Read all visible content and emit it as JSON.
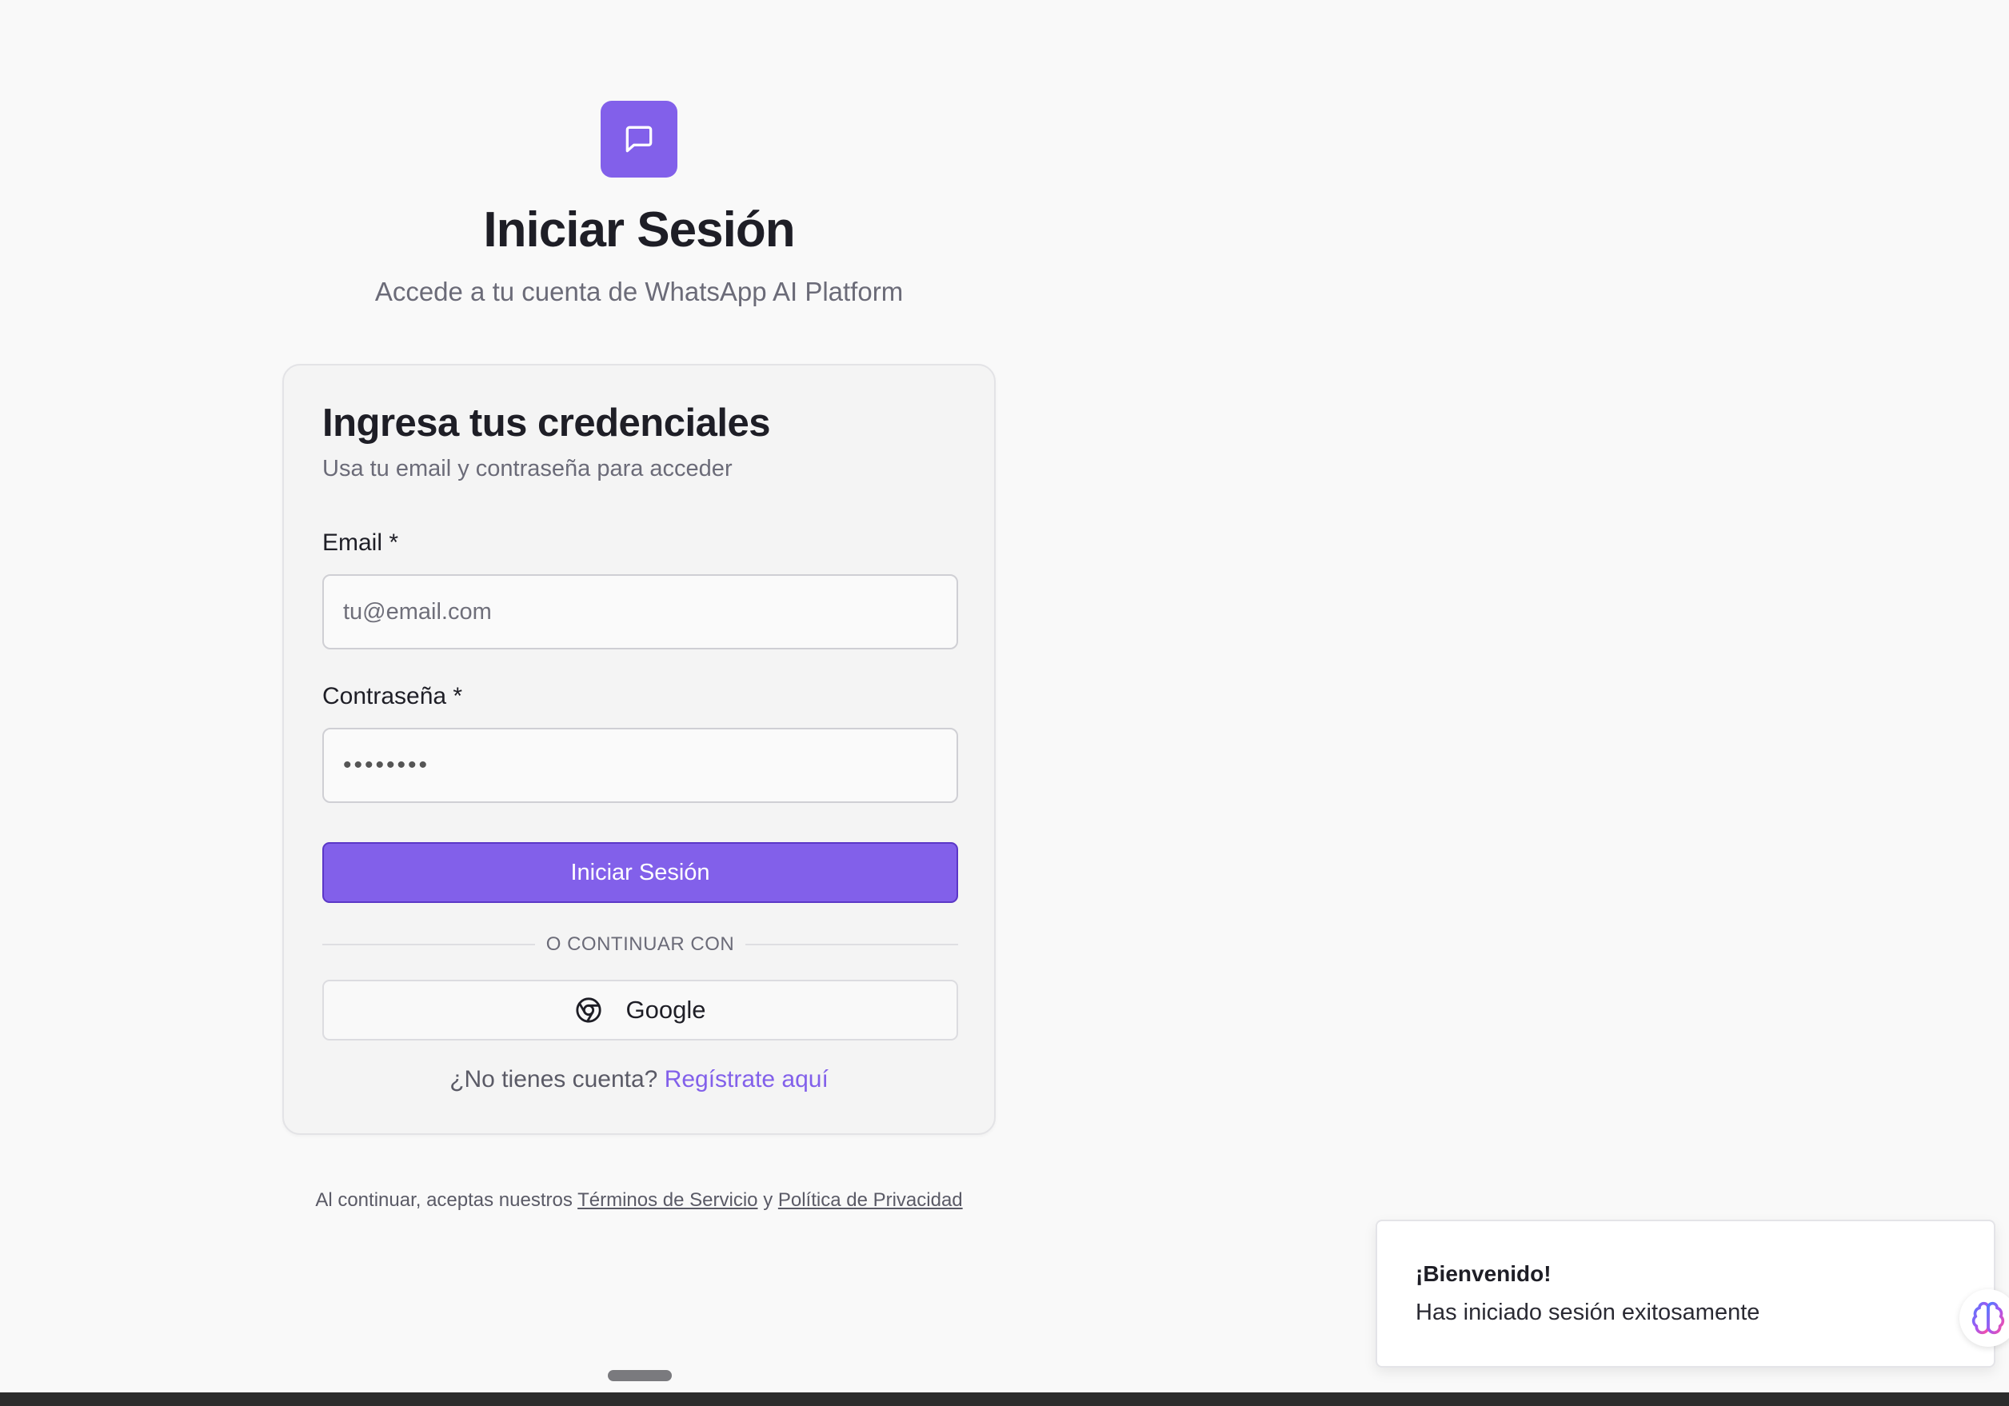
{
  "header": {
    "title": "Iniciar Sesión",
    "subtitle": "Accede a tu cuenta de WhatsApp AI Platform",
    "logo_icon": "message-square-icon"
  },
  "card": {
    "title": "Ingresa tus credenciales",
    "subtitle": "Usa tu email y contraseña para acceder",
    "email": {
      "label": "Email *",
      "placeholder": "tu@email.com",
      "value": ""
    },
    "password": {
      "label": "Contraseña *",
      "value": "••••••••"
    },
    "submit_label": "Iniciar Sesión",
    "divider_text": "O CONTINUAR CON",
    "google": {
      "label": "Google",
      "icon": "chrome-icon"
    },
    "signup": {
      "prompt": "¿No tienes cuenta?",
      "link": "Regístrate aquí"
    }
  },
  "legal": {
    "prefix": "Al continuar, aceptas nuestros",
    "terms": "Términos de Servicio",
    "conjunction": "y",
    "privacy": "Política de Privacidad"
  },
  "toast": {
    "title": "¡Bienvenido!",
    "message": "Has iniciado sesión exitosamente"
  },
  "colors": {
    "accent": "#8260ea",
    "background": "#f9f9f9",
    "card": "#f4f4f4"
  }
}
